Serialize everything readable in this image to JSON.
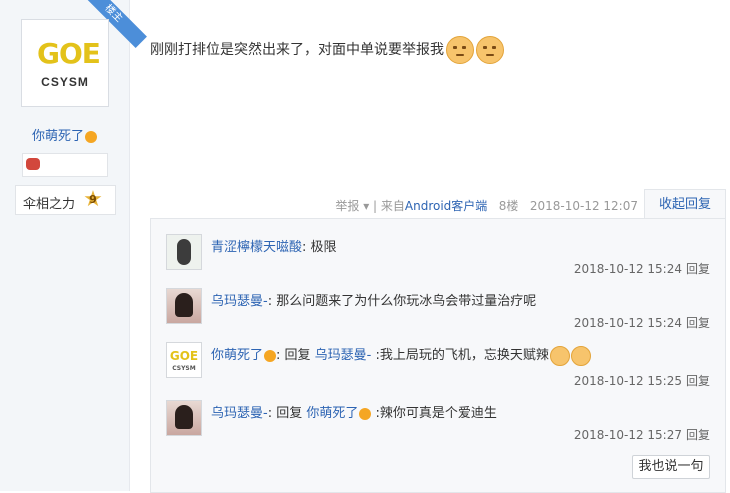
{
  "author": {
    "badge": "楼主",
    "logo_glyph": "GOE",
    "logo_text": "CSYSM",
    "name": "你萌死了",
    "level_name": "伞相之力",
    "level_num": "9"
  },
  "post": {
    "content": "刚刚打排位是突然出来了，对面中单说要举报我",
    "meta": {
      "report": "举报",
      "from_prefix": "| 来自",
      "client": "Android客户端",
      "floor": "8楼",
      "time": "2018-10-12 12:07"
    },
    "collapse_label": "收起回复"
  },
  "replies": [
    {
      "user": "青涩檸檬天嗞酸",
      "sep": ":",
      "text": "极限",
      "time": "2018-10-12 15:24",
      "reply_label": "回复"
    },
    {
      "user": "乌玛瑟曼-",
      "sep": ":",
      "text": "那么问题来了为什么你玩冰鸟会带过量治疗呢",
      "time": "2018-10-12 15:24",
      "reply_label": "回复"
    },
    {
      "user": "你萌死了",
      "sep": ": 回复",
      "target": "乌玛瑟曼-",
      "text": ":我上局玩的飞机，忘换天赋辣",
      "time": "2018-10-12 15:25",
      "reply_label": "回复"
    },
    {
      "user": "乌玛瑟曼-",
      "sep": ": 回复",
      "target": "你萌死了",
      "text": ":辣你可真是个爱迪生",
      "time": "2018-10-12 15:27",
      "reply_label": "回复"
    }
  ],
  "say_button": "我也说一句",
  "colors": {
    "link": "#2d64b3",
    "badge": "#4c8ed9",
    "logo": "#e3c21a"
  }
}
